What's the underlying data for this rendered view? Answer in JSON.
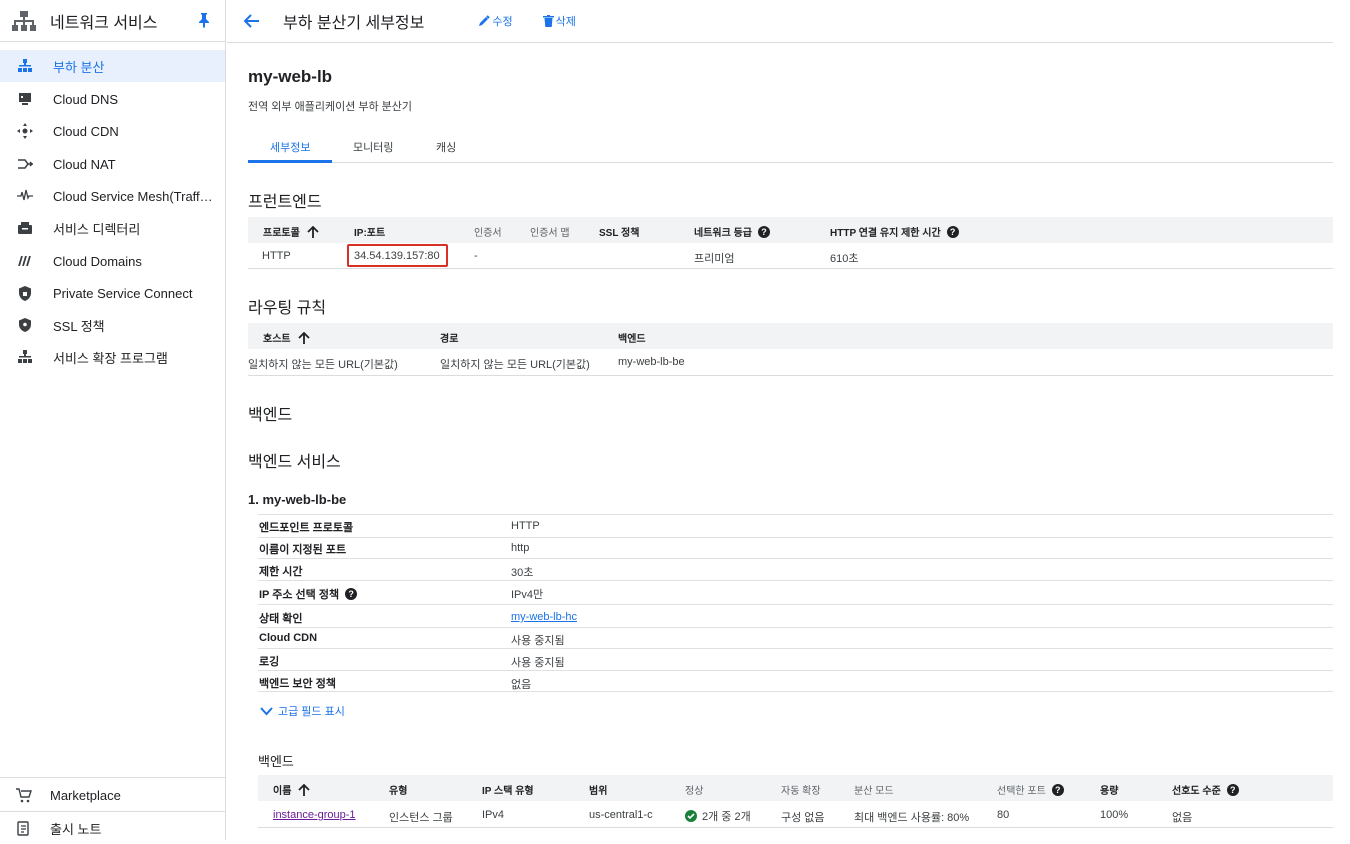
{
  "sidebar": {
    "title": "네트워크 서비스",
    "items": [
      {
        "label": "부하 분산",
        "icon": "load-balancing-icon",
        "active": true
      },
      {
        "label": "Cloud DNS",
        "icon": "dns-icon"
      },
      {
        "label": "Cloud CDN",
        "icon": "cdn-icon"
      },
      {
        "label": "Cloud NAT",
        "icon": "nat-icon"
      },
      {
        "label": "Cloud Service Mesh(Traffi...",
        "icon": "service-mesh-icon"
      },
      {
        "label": "서비스 디렉터리",
        "icon": "service-directory-icon"
      },
      {
        "label": "Cloud Domains",
        "icon": "domains-icon"
      },
      {
        "label": "Private Service Connect",
        "icon": "private-service-connect-icon"
      },
      {
        "label": "SSL 정책",
        "icon": "ssl-policy-icon"
      },
      {
        "label": "서비스 확장 프로그램",
        "icon": "service-extensions-icon"
      }
    ],
    "bottom": [
      {
        "label": "Marketplace",
        "icon": "cart-icon"
      },
      {
        "label": "출시 노트",
        "icon": "release-notes-icon"
      }
    ]
  },
  "topbar": {
    "title": "부하 분산기 세부정보",
    "edit_label": "수정",
    "delete_label": "삭제"
  },
  "lb": {
    "name": "my-web-lb",
    "subtitle": "전역 외부 애플리케이션 부하 분산기"
  },
  "tabs": [
    "세부정보",
    "모니터링",
    "캐싱"
  ],
  "frontend": {
    "heading": "프런트엔드",
    "headers": [
      "프로토콜",
      "IP:포트",
      "인증서",
      "인증서 맵",
      "SSL 정책",
      "네트워크 등급",
      "HTTP 연결 유지 제한 시간"
    ],
    "row": [
      "HTTP",
      "34.54.139.157:80",
      "-",
      "",
      "",
      "프리미엄",
      "610초"
    ]
  },
  "routing": {
    "heading": "라우팅 규칙",
    "headers": [
      "호스트",
      "경로",
      "백엔드"
    ],
    "row": [
      "일치하지 않는 모든 URL(기본값)",
      "일치하지 않는 모든 URL(기본값)",
      "my-web-lb-be"
    ]
  },
  "backend": {
    "heading": "백엔드",
    "services_heading": "백엔드 서비스",
    "service_title": "1. my-web-lb-be",
    "props": [
      {
        "k": "엔드포인트 프로토콜",
        "v": "HTTP"
      },
      {
        "k": "이름이 지정된 포트",
        "v": "http"
      },
      {
        "k": "제한 시간",
        "v": "30초"
      },
      {
        "k": "IP 주소 선택 정책",
        "v": "IPv4만",
        "help": true
      },
      {
        "k": "상태 확인",
        "v": "my-web-lb-hc",
        "link": true
      },
      {
        "k": "Cloud CDN",
        "v": "사용 중지됨"
      },
      {
        "k": "로깅",
        "v": "사용 중지됨"
      },
      {
        "k": "백엔드 보안 정책",
        "v": "없음"
      }
    ],
    "advanced_label": "고급 필드 표시",
    "backends_heading": "백엔드",
    "table_headers": [
      "이름",
      "유형",
      "IP 스택 유형",
      "범위",
      "정상",
      "자동 확장",
      "분산 모드",
      "선택한 포트",
      "용량",
      "선호도 수준"
    ],
    "table_row": [
      "instance-group-1",
      "인스턴스 그룹",
      "IPv4",
      "us-central1-c",
      "2개 중 2개",
      "구성 없음",
      "최대 백엔드 사용률: 80%",
      "80",
      "100%",
      "없음"
    ]
  },
  "colors": {
    "accent": "#1a73e8",
    "highlight": "#d93025",
    "healthy": "#188038"
  }
}
